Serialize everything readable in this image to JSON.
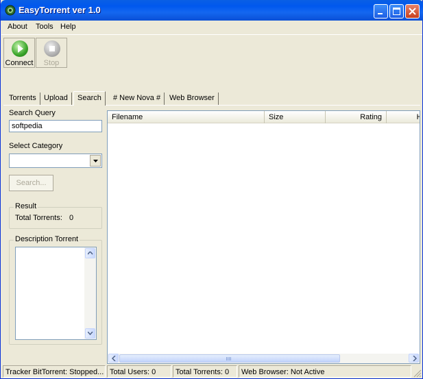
{
  "window": {
    "title": "EasyTorrent ver 1.0",
    "title_icon": "app-icon",
    "controls": [
      "minimize-icon",
      "maximize-icon",
      "close-icon"
    ]
  },
  "menu": {
    "items": [
      {
        "label": "About"
      },
      {
        "label": "Tools"
      },
      {
        "label": "Help"
      }
    ]
  },
  "toolbar": {
    "connect_label": "Connect",
    "stop_label": "Stop"
  },
  "tabs": [
    {
      "label": "Torrents"
    },
    {
      "label": "Upload"
    },
    {
      "label": "Search",
      "active": true
    },
    {
      "label": "# New Nova #"
    },
    {
      "label": "Web Browser"
    }
  ],
  "search": {
    "query_label": "Search Query",
    "query_value": "softpedia",
    "category_label": "Select Category",
    "category_value": "",
    "search_button": "Search..."
  },
  "result": {
    "group_title": "Result",
    "total_label": "Total Torrents:",
    "total_value": "0"
  },
  "description": {
    "group_title": "Description Torrent",
    "text": ""
  },
  "results_table": {
    "columns": [
      "Filename",
      "Size",
      "Rating",
      "Hi"
    ],
    "rows": []
  },
  "status": {
    "tracker": "Tracker BitTorrent: Stopped...",
    "users": "Total Users: 0",
    "torrents": "Total Torrents: 0",
    "browser": "Web Browser: Not Active"
  },
  "colors": {
    "titlebar": "#0058ee",
    "window_bg": "#ece9d8",
    "border_blue": "#7f9db9"
  }
}
